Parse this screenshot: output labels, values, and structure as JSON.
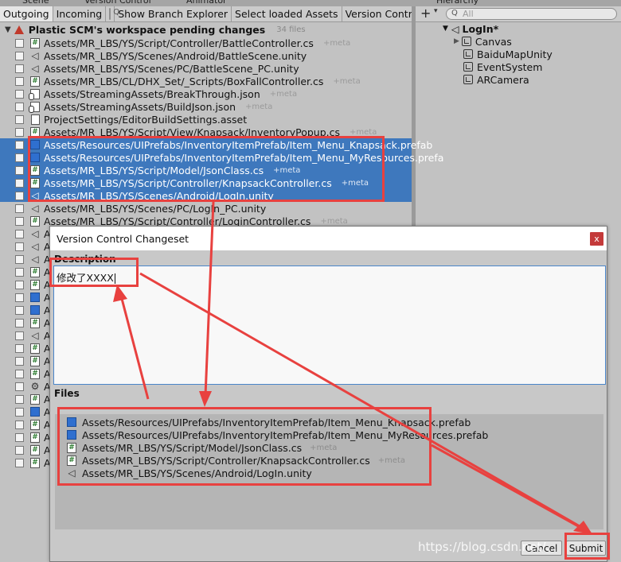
{
  "editor_tabs": [
    "Scene",
    "Version Control",
    "Animator",
    "Hierarchy"
  ],
  "vc_toolbar": {
    "outgoing": "Outgoing",
    "incoming": "Incoming",
    "search_placeholder": "Q",
    "show_branch_explorer": "Show Branch Explorer",
    "select_loaded_assets": "Select loaded Assets",
    "version_control": "Version Contr"
  },
  "pending": {
    "title": "Plastic SCM's workspace pending changes",
    "count": "34 files",
    "rows": [
      {
        "icon": "cs-icon",
        "path": "Assets/MR_LBS/YS/Script/Controller/BattleController.cs",
        "meta": "+meta",
        "selected": false
      },
      {
        "icon": "unity-icon",
        "path": "Assets/MR_LBS/YS/Scenes/Android/BattleScene.unity",
        "meta": "",
        "selected": false
      },
      {
        "icon": "unity-icon",
        "path": "Assets/MR_LBS/YS/Scenes/PC/BattleScene_PC.unity",
        "meta": "",
        "selected": false
      },
      {
        "icon": "cs-icon",
        "path": "Assets/MR_LBS/CL/DHX_Set/_Scripts/BoxFallController.cs",
        "meta": "+meta",
        "selected": false
      },
      {
        "icon": "json-icon",
        "path": "Assets/StreamingAssets/BreakThrough.json",
        "meta": "+meta",
        "selected": false
      },
      {
        "icon": "json-icon",
        "path": "Assets/StreamingAssets/BuildJson.json",
        "meta": "+meta",
        "selected": false
      },
      {
        "icon": "document-icon",
        "path": "ProjectSettings/EditorBuildSettings.asset",
        "meta": "",
        "selected": false
      },
      {
        "icon": "cs-icon",
        "path": "Assets/MR_LBS/YS/Script/View/Knapsack/InventoryPopup.cs",
        "meta": "+meta",
        "selected": false
      },
      {
        "icon": "prefab-icon",
        "path": "Assets/Resources/UIPrefabs/InventoryItemPrefab/Item_Menu_Knapsack.prefab",
        "meta": "",
        "selected": true
      },
      {
        "icon": "prefab-icon",
        "path": "Assets/Resources/UIPrefabs/InventoryItemPrefab/Item_Menu_MyResources.prefa",
        "meta": "",
        "selected": true
      },
      {
        "icon": "cs-icon",
        "path": "Assets/MR_LBS/YS/Script/Model/JsonClass.cs",
        "meta": "+meta",
        "selected": true
      },
      {
        "icon": "cs-icon",
        "path": "Assets/MR_LBS/YS/Script/Controller/KnapsackController.cs",
        "meta": "+meta",
        "selected": true
      },
      {
        "icon": "unity-icon",
        "path": "Assets/MR_LBS/YS/Scenes/Android/LogIn.unity",
        "meta": "",
        "selected": true
      },
      {
        "icon": "unity-icon",
        "path": "Assets/MR_LBS/YS/Scenes/PC/LogIn_PC.unity",
        "meta": "",
        "selected": false
      },
      {
        "icon": "cs-icon",
        "path": "Assets/MR_LBS/YS/Script/Controller/LoginController.cs",
        "meta": "+meta",
        "selected": false
      }
    ],
    "hidden_rows_icons": [
      "unity-icon",
      "unity-icon",
      "unity-icon",
      "cs-icon",
      "cs-icon",
      "prefab-icon",
      "prefab-icon",
      "cs-icon",
      "unity-icon",
      "cs-icon",
      "cs-icon",
      "cs-icon",
      "gear-icon",
      "cs-icon",
      "prefab-icon",
      "cs-icon",
      "cs-icon",
      "cs-icon",
      "cs-icon"
    ],
    "hidden_rows_prefix": "A"
  },
  "hierarchy": {
    "plus": "+",
    "search_placeholder": "All",
    "root": "LogIn*",
    "children": [
      "Canvas",
      "BaiduMapUnity",
      "EventSystem",
      "ARCamera"
    ]
  },
  "dialog": {
    "title": "Version Control Changeset",
    "close": "x",
    "description_label": "Description",
    "description_text": "修改了XXXX",
    "files_label": "Files",
    "files": [
      {
        "icon": "prefab-icon",
        "path": "Assets/Resources/UIPrefabs/InventoryItemPrefab/Item_Menu_Knapsack.prefab",
        "meta": ""
      },
      {
        "icon": "prefab-icon",
        "path": "Assets/Resources/UIPrefabs/InventoryItemPrefab/Item_Menu_MyResources.prefab",
        "meta": ""
      },
      {
        "icon": "cs-icon",
        "path": "Assets/MR_LBS/YS/Script/Model/JsonClass.cs",
        "meta": "+meta"
      },
      {
        "icon": "cs-icon",
        "path": "Assets/MR_LBS/YS/Script/Controller/KnapsackController.cs",
        "meta": "+meta"
      },
      {
        "icon": "unity-icon",
        "path": "Assets/MR_LBS/YS/Scenes/Android/LogIn.unity",
        "meta": ""
      }
    ],
    "cancel": "Cancel",
    "submit": "Submit"
  },
  "watermark": "https://blog.csdn.net/...",
  "colors": {
    "selection": "#3e78bd",
    "annotation": "#e8413f",
    "prefab": "#2f6fcf"
  }
}
